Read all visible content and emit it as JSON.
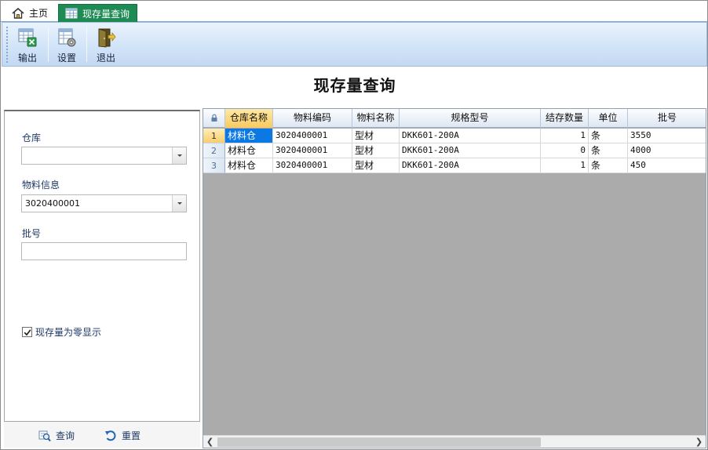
{
  "tabs": {
    "home_label": "主页",
    "active_label": "现存量查询"
  },
  "toolbar": {
    "export_label": "输出",
    "settings_label": "设置",
    "exit_label": "退出"
  },
  "page": {
    "title": "现存量查询"
  },
  "filters": {
    "warehouse_label": "仓库",
    "warehouse_value": "",
    "material_label": "物料信息",
    "material_value": "3020400001",
    "batch_label": "批号",
    "batch_value": "",
    "show_zero_label": "现存量为零显示",
    "show_zero_checked": true
  },
  "actions": {
    "query_label": "查询",
    "reset_label": "重置"
  },
  "grid": {
    "columns": [
      "仓库名称",
      "物料编码",
      "物料名称",
      "规格型号",
      "结存数量",
      "单位",
      "批号"
    ],
    "rows": [
      {
        "no": "1",
        "warehouse": "材料仓",
        "code": "3020400001",
        "name": "型材",
        "spec": "DKK601-200A",
        "qty": "1",
        "unit": "条",
        "batch": "3550"
      },
      {
        "no": "2",
        "warehouse": "材料仓",
        "code": "3020400001",
        "name": "型材",
        "spec": "DKK601-200A",
        "qty": "0",
        "unit": "条",
        "batch": "4000"
      },
      {
        "no": "3",
        "warehouse": "材料仓",
        "code": "3020400001",
        "name": "型材",
        "spec": "DKK601-200A",
        "qty": "1",
        "unit": "条",
        "batch": "450"
      }
    ]
  },
  "colors": {
    "active_tab": "#1e8a54",
    "toolbar_top": "#eaf3fd",
    "grid_empty": "#ababab",
    "focus_cell": "#0b78e3"
  },
  "icons": [
    "home-icon",
    "table-icon",
    "export-icon",
    "settings-icon",
    "exit-icon",
    "lock-icon",
    "checkmark-icon",
    "search-icon",
    "reset-icon",
    "chevron-down-icon",
    "scroll-left-icon",
    "scroll-right-icon"
  ]
}
